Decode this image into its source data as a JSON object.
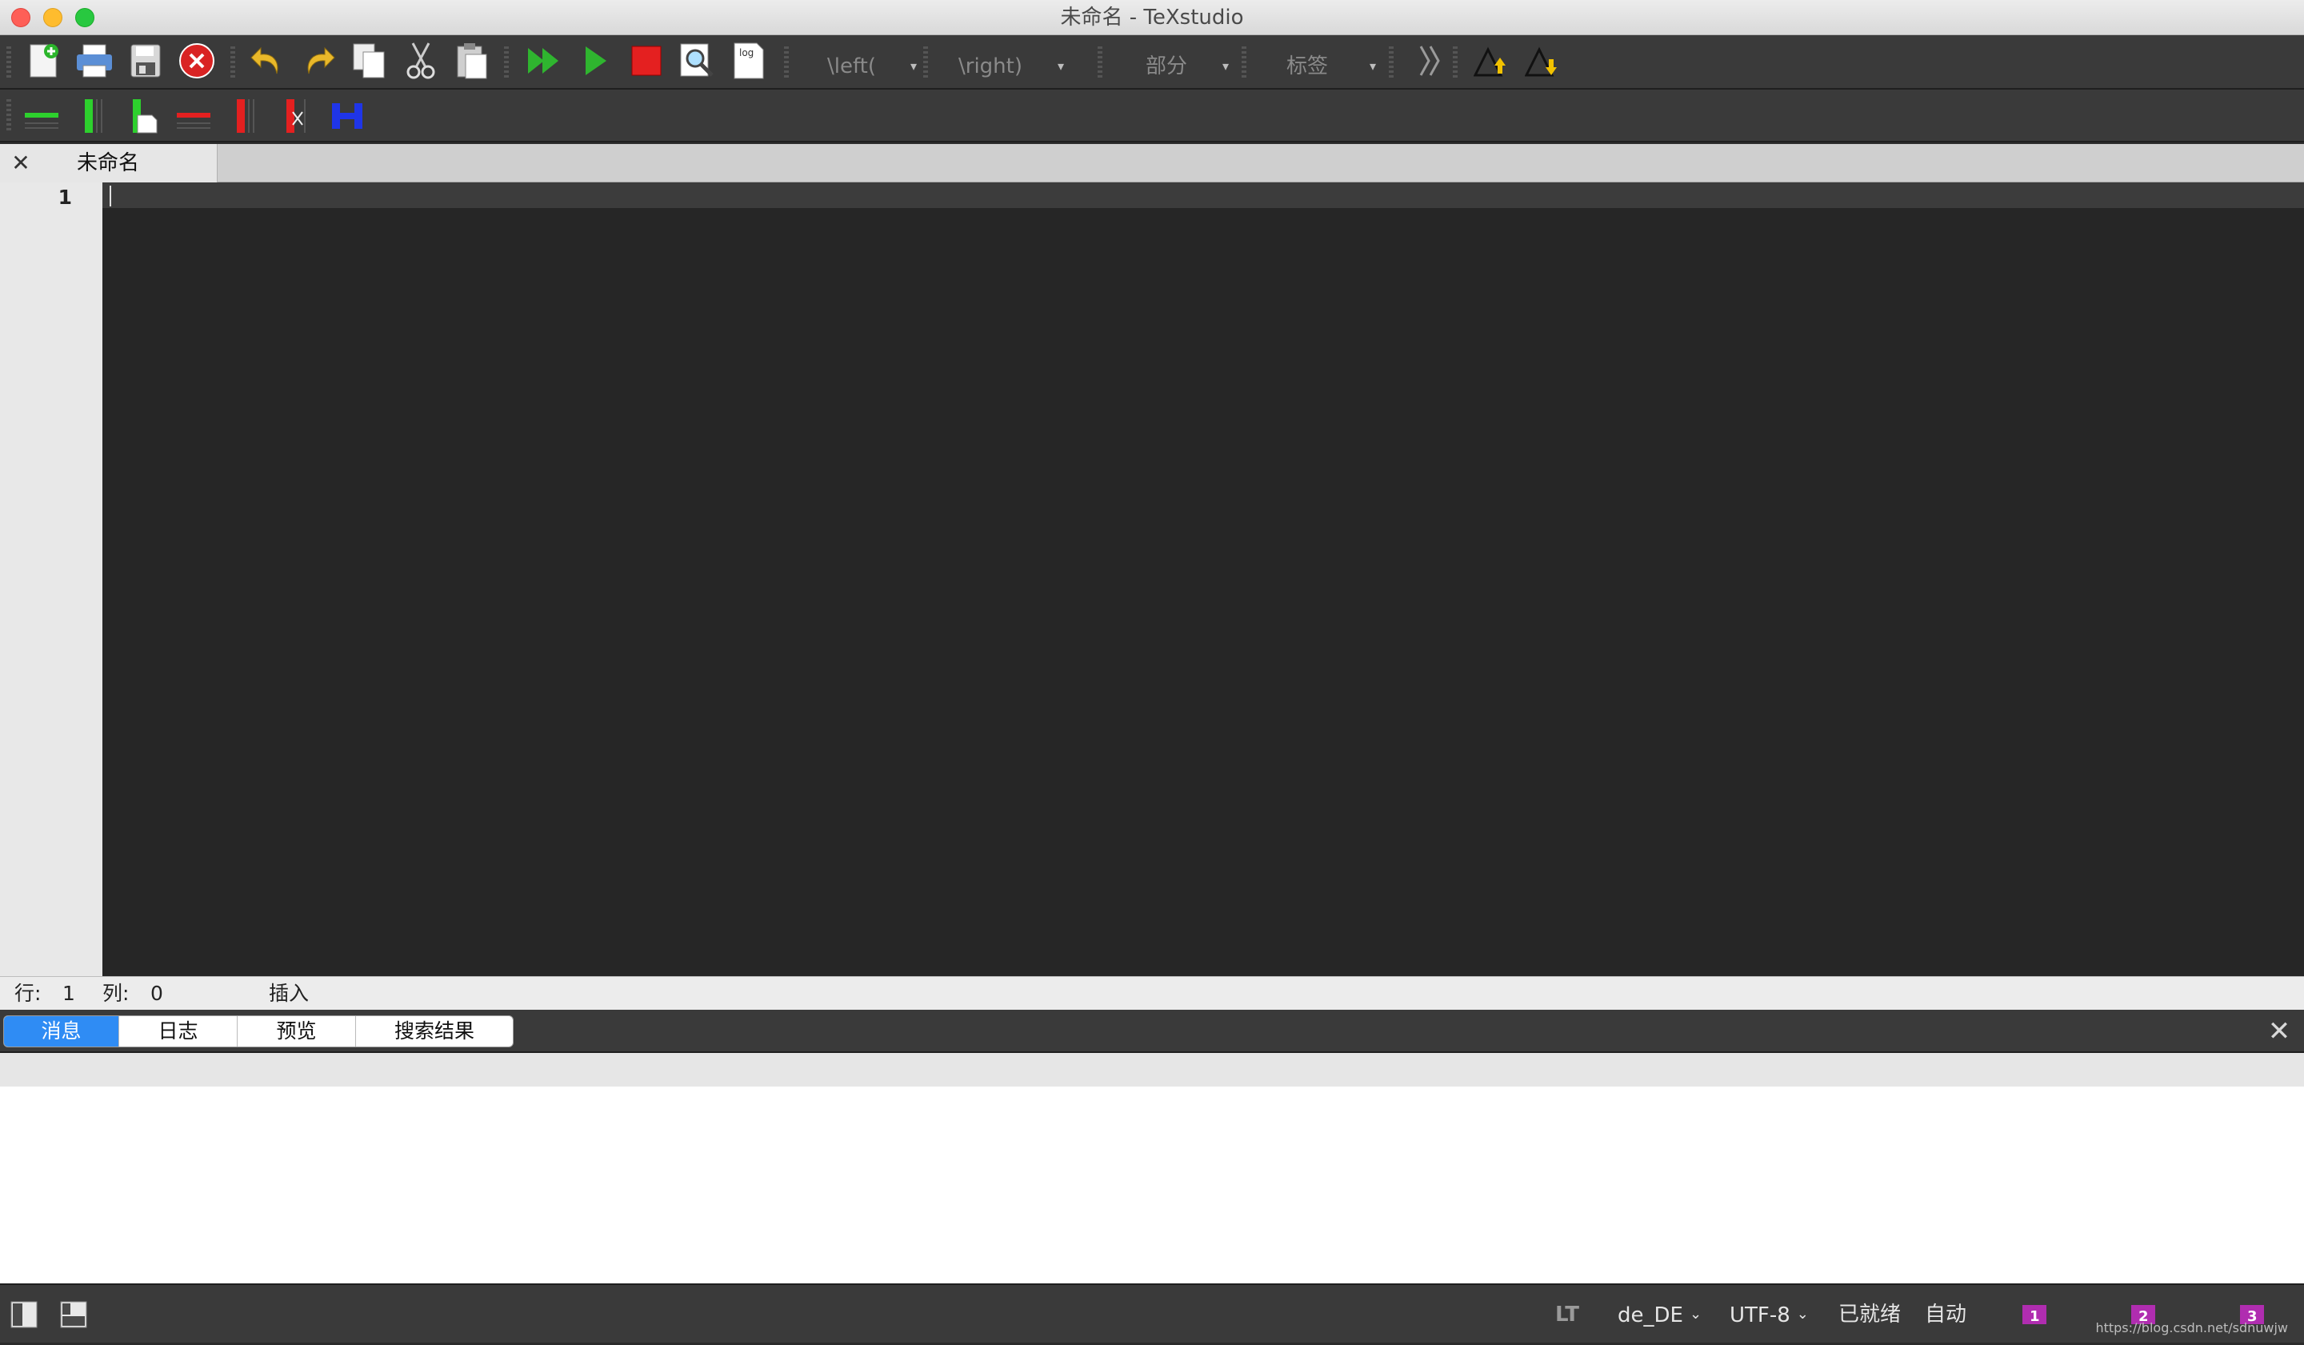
{
  "window": {
    "title": "未命名 - TeXstudio"
  },
  "toolbar": {
    "icons": [
      "new-file-icon",
      "print-icon",
      "save-icon",
      "close-document-icon",
      "undo-icon",
      "redo-icon",
      "copy-icon",
      "cut-icon",
      "paste-icon",
      "build-view-icon",
      "compile-icon",
      "stop-icon",
      "view-pdf-icon",
      "log-icon"
    ],
    "log_label": "log",
    "left_combo": "\\left(",
    "right_combo": "\\right)",
    "section_combo": "部分",
    "label_combo": "标签",
    "more_icon": "double-chevron-icon",
    "up_icon": "triangle-up-icon",
    "down_icon": "triangle-down-icon"
  },
  "table_toolbar": {
    "icons": [
      "add-row-icon",
      "add-column-icon",
      "align-column-icon",
      "remove-row-icon",
      "remove-column-icon",
      "remove-cell-icon",
      "split-column-icon"
    ]
  },
  "tabs": [
    {
      "label": "未命名",
      "close": "✕"
    }
  ],
  "editor": {
    "line_numbers": [
      "1"
    ]
  },
  "editor_status": {
    "line_label": "行:",
    "line_value": "1",
    "col_label": "列:",
    "col_value": "0",
    "mode": "插入"
  },
  "panel": {
    "tabs": [
      "消息",
      "日志",
      "预览",
      "搜索结果"
    ],
    "active_tab": 0,
    "close": "✕"
  },
  "statusbar": {
    "lt": "LT",
    "language": "de_DE",
    "encoding": "UTF-8",
    "status": "已就绪",
    "mode": "自动",
    "bookmarks": [
      "1",
      "2",
      "3"
    ],
    "watermark": "https://blog.csdn.net/sdnuwjw"
  },
  "colors": {
    "accent": "#2f8cf4",
    "editor_bg": "#262626",
    "toolbar_bg": "#3a3a3a"
  }
}
